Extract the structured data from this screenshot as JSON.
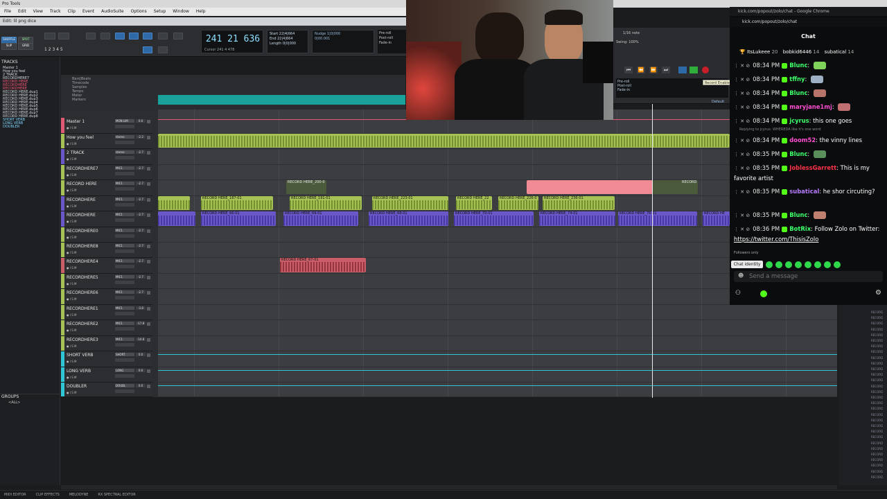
{
  "window": {
    "title": "Pro Tools",
    "edit_title": "Edit: lil png dice"
  },
  "menu": [
    "File",
    "Edit",
    "View",
    "Track",
    "Clip",
    "Event",
    "AudioSuite",
    "Options",
    "Setup",
    "Window",
    "Help"
  ],
  "toolbar": {
    "counter_main": "241 21 636",
    "counter_cursor": "Cursor  241 4 478",
    "startend": [
      "Start  22|4|664",
      "End  22|4|664",
      "Length  0|0|000"
    ],
    "nudge": [
      "Nudge  1|0|000",
      "0|00.001"
    ],
    "preroll": [
      "Pre-roll",
      "Post-roll",
      "Fade-in"
    ],
    "mode_buttons": [
      "SHUFFLE",
      "SPOT",
      "SLIP",
      "GRID"
    ],
    "counter_nums": "1 2 3 4 5"
  },
  "tracks_panel": {
    "header": "TRACKS",
    "items": [
      "Master 1",
      "How you feel",
      "2 TRACK",
      "RECORDHERE7",
      "RECORD HERE",
      "RECORDHERE",
      "RECORDHERE",
      "RECORD HERE.dup1",
      "RECORD HERE.dup2",
      "RECORD HERE.dup3",
      "RECORD HERE.dup4",
      "RECORD HERE.dup5",
      "RECORD HERE.dup6",
      "RECORD HERE.dup7",
      "RECORD HERE.dup8",
      "SHORT VERB",
      "LONG VERB",
      "DOUBLER"
    ],
    "groups_header": "GROUPS",
    "groups_all": "<ALL>"
  },
  "rulers": [
    "Bars|Beats",
    "Timecode",
    "Samples",
    "Tempo",
    "Meter",
    "Markers"
  ],
  "edit_tracks": [
    {
      "name": "Master 1",
      "color": "#e05a76",
      "ins": "MON LIM",
      "vol": "0.0"
    },
    {
      "name": "How you feel",
      "color": "#a6c254",
      "ins": "stereo",
      "vol": "-2.2"
    },
    {
      "name": "2 TRACK",
      "color": "#6a58c9",
      "ins": "stereo",
      "vol": "-2.7"
    },
    {
      "name": "RECORDHERE7",
      "color": "#a6c254",
      "ins": "MIC1",
      "vol": "-2.7"
    },
    {
      "name": "RECORD HERE",
      "color": "#a6c254",
      "ins": "MIC1",
      "vol": "-2.7"
    },
    {
      "name": "RECORDHERE",
      "color": "#6a58c9",
      "ins": "MIC1",
      "vol": "-2.7"
    },
    {
      "name": "RECORDHERE",
      "color": "#6a58c9",
      "ins": "MIC1",
      "vol": "-2.7"
    },
    {
      "name": "RECORDHERE0",
      "color": "#a6c254",
      "ins": "MIC1",
      "vol": "-2.7"
    },
    {
      "name": "RECORDHERE8",
      "color": "#a6c254",
      "ins": "MIC1",
      "vol": "-2.7"
    },
    {
      "name": "RECORDHERE4",
      "color": "#c95e68",
      "ins": "MIC1",
      "vol": "-2.7"
    },
    {
      "name": "RECORDHERE5",
      "color": "#a6c254",
      "ins": "MIC1",
      "vol": "-2.7"
    },
    {
      "name": "RECORDHERE6",
      "color": "#a6c254",
      "ins": "MIC1",
      "vol": "-2.7"
    },
    {
      "name": "RECORDHERE1",
      "color": "#a6c254",
      "ins": "MIC1",
      "vol": "-3.8"
    },
    {
      "name": "RECORDHERE2",
      "color": "#a6c254",
      "ins": "MIC1",
      "vol": "-17.8"
    },
    {
      "name": "RECORDHERE3",
      "color": "#a6c254",
      "ins": "MIC1",
      "vol": "-14.8"
    },
    {
      "name": "SHORT VERB",
      "color": "#2fc7d6",
      "ins": "SHORT",
      "vol": "0.0"
    },
    {
      "name": "LONG VERB",
      "color": "#2fc7d6",
      "ins": "LONG",
      "vol": "0.0"
    },
    {
      "name": "DOUBLER",
      "color": "#2fc7d6",
      "ins": "DOUBL",
      "vol": "0.0"
    }
  ],
  "clips": {
    "a": "RECORD HERE_200-0",
    "b": "RECORD HERE_187-01",
    "c": "RECORD HERE_191-01",
    "d": "RECORD HERE_223-01",
    "e": "RECORD HERE_22",
    "f": "RECORD HERE_226-0",
    "g": "RECORD HERE_236-01",
    "h": "RECORD HERE_66-01",
    "i": "RECORD HERE_69-01",
    "j": "RECORD HERE_68-01",
    "k": "RECORD HERE_70-01",
    "l": "RECORD HERE_74-01",
    "m": "RECORD HERE_76-01",
    "n": "RECORD HERE_67-01",
    "o": "RECORD",
    "p": "RECORD HE"
  },
  "transport": {
    "tooltip": "Record Enable",
    "grid": "1/16 note",
    "swing": "Swing: 100%",
    "default": "Default"
  },
  "chat": {
    "window_title": "kick.com/popout/zolo/chat - Google Chrome",
    "url": "kick.com/popout/zolo/chat",
    "header": "Chat",
    "leaders": [
      {
        "name": "ItsLukeee",
        "count": "20"
      },
      {
        "name": "bobkid6446",
        "count": "14"
      },
      {
        "name": "subatical",
        "count": "14"
      }
    ],
    "messages": [
      {
        "time": "08:34 PM",
        "user": "Blunc",
        "text": "",
        "ucls": "u-green"
      },
      {
        "time": "08:34 PM",
        "user": "tffny",
        "text": "",
        "ucls": "u-green"
      },
      {
        "time": "08:34 PM",
        "user": "Blunc",
        "text": "",
        "ucls": "u-green"
      },
      {
        "time": "08:34 PM",
        "user": "maryjane1mj",
        "text": "",
        "ucls": "u-pink"
      },
      {
        "time": "08:34 PM",
        "user": "jcyrus",
        "text": "this one goes",
        "ucls": "u-green"
      },
      {
        "time": "08:34 PM",
        "user": "doom52",
        "text": "the vinny lines",
        "ucls": "u-pink"
      },
      {
        "time": "08:35 PM",
        "user": "Blunc",
        "text": "",
        "ucls": "u-green"
      },
      {
        "time": "08:35 PM",
        "user": "JoblessGarrett",
        "text": "This is my favorite artist",
        "ucls": "u-red"
      },
      {
        "time": "08:35 PM",
        "user": "subatical",
        "text": "he shor circuting?",
        "ucls": "u-purple"
      },
      {
        "time": "08:35 PM",
        "user": "Blunc",
        "text": "",
        "ucls": "u-green"
      },
      {
        "time": "08:36 PM",
        "user": "BotRix",
        "text": "Follow Zolo on Twitter: ",
        "ucls": "u-green"
      }
    ],
    "reply_note": "Replying to jcyrus: WHEREDA like it's one word",
    "link": "https://twitter.com/ThisisZolo",
    "followers_only": "Followers only",
    "identity_tip": "Chat identity",
    "send_placeholder": "Send a message"
  },
  "bottom_bar": [
    "MIDI EDITOR",
    "CLIP EFFECTS",
    "MELODYNE",
    "RX SPECTRAL EDITOR"
  ],
  "right_strip_label": "RECORD"
}
